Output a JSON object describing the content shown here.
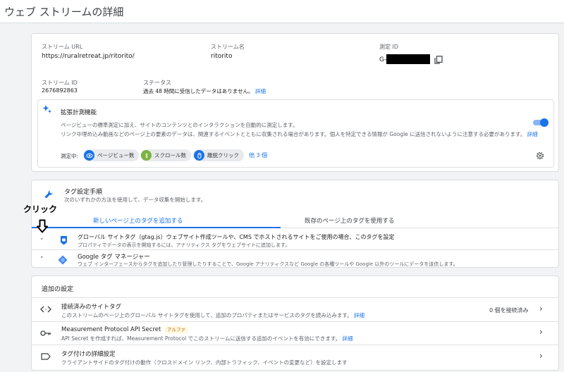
{
  "page": {
    "title": "ウェブ ストリームの詳細"
  },
  "stream": {
    "url_label": "ストリーム URL",
    "url_value": "https://ruralretreat.jp/ritorito/",
    "name_label": "ストリーム名",
    "name_value": "ritorito",
    "mid_label": "測定 ID",
    "mid_value": "G-",
    "id_label": "ストリーム ID",
    "id_value": "2676892863",
    "status_label": "ステータス",
    "status_value": "過去 48 時間に受信したデータはありません。",
    "status_link": "詳細"
  },
  "enhanced": {
    "title": "拡張計測機能",
    "desc1": "ページビューの標準測定に加え、サイトのコンテンツとのインタラクションを自動的に測定します。",
    "desc2": "リンク中埋め込み動画などのページ上の要素のデータは、関連するイベントとともに収集される場合があります。個人を特定できる情報が Google に送信されないように注意する必要があります。",
    "desc2_link": "詳細",
    "measuring_label": "測定中:",
    "chips": [
      "ページビュー数",
      "スクロール数",
      "離脱クリック"
    ],
    "more_link": "他 3 個",
    "toggle_on": true
  },
  "tag_setup": {
    "title": "タグ設定手順",
    "subtitle": "次のいずれかの方法を使用して、データ収集を開始します。",
    "tabs": [
      "新しいページ上のタグを追加する",
      "既存のページ上のタグを使用する"
    ],
    "items": [
      {
        "title": "グローバル サイトタグ（gtag.js）ウェブサイト作成ツールや、CMS でホストされるサイトをご使用の場合、このタグを設定",
        "desc": "プロパティでデータの表示を開始するには、アナリティクス タグをウェブサイトに追加します。"
      },
      {
        "title": "Google タグ マネージャー",
        "desc": "ウェブ インターフェースからタグを追加したり管理したりすることで、Google アナリティクスなど Google の各種ツールや Google 以外のツールにデータを送信します。"
      }
    ]
  },
  "annotation": {
    "text": "クリック"
  },
  "additional": {
    "title": "追加の設定",
    "rows": [
      {
        "title": "接続済みのサイトタグ",
        "desc": "このストリームのページ上のグローバル サイトタグを使用して、追加のプロパティまたはサービスのタグを読み込みます。",
        "link": "詳細",
        "right_text": "0 個を接続済み"
      },
      {
        "title": "Measurement Protocol API Secret",
        "badge": "アルファ",
        "desc": "API Secret を作成すれば、Measurement Protocol でこのストリームに送信する追加のイベントを有効にできます。",
        "link": "詳細"
      },
      {
        "title": "タグ付けの詳細設定",
        "desc": "クライアントサイドのタグ付けの動作（クロスドメイン リンク、内部トラフィック、イベントの変更など）を設定します"
      }
    ]
  },
  "colors": {
    "accent": "#1a73e8",
    "chip_pageview": "#1a73e8",
    "chip_scroll": "#7cb342",
    "chip_click": "#1a73e8",
    "badge_bg": "#fef7e0",
    "badge_fg": "#b06000"
  },
  "icons": {
    "copy": "copy-icon",
    "sparkle": "sparkle-icon",
    "settings": "gear-icon",
    "wrench": "wrench-icon",
    "tag": "tag-icon",
    "gtm": "gtm-icon",
    "code": "code-icon",
    "key": "key-icon",
    "label": "label-icon"
  }
}
